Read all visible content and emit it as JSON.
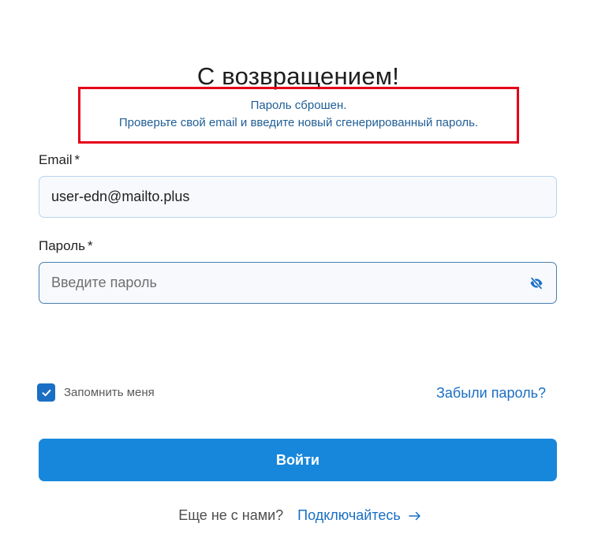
{
  "page": {
    "title": "С возвращением!"
  },
  "alert": {
    "line1": "Пароль сброшен.",
    "line2": "Проверьте свой email и введите новый сгенерированный пароль."
  },
  "form": {
    "email_label": "Email",
    "email_required": "*",
    "email_value": "user-edn@mailto.plus",
    "password_label": "Пароль",
    "password_required": "*",
    "password_placeholder": "Введите пароль",
    "password_toggle_icon": "eye-slash-icon",
    "remember_label": "Запомнить меня",
    "remember_checked": true,
    "forgot_link": "Забыли пароль?",
    "submit_label": "Войти"
  },
  "footer": {
    "question": "Еще не с нами?",
    "signup_link": "Подключайтесь",
    "signup_icon": "arrow-right-icon"
  },
  "colors": {
    "primary": "#1787dc",
    "link": "#1a6fc4",
    "alert_border": "#e4001b",
    "alert_text": "#1f5e96"
  }
}
